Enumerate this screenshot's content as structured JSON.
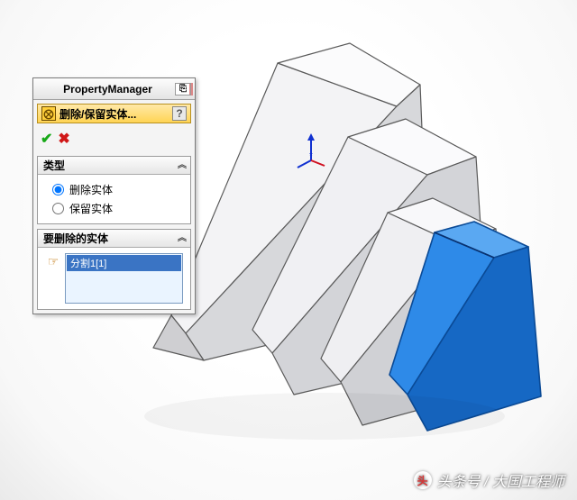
{
  "panel": {
    "title": "PropertyManager",
    "feature_name": "删除/保留实体...",
    "help_label": "?"
  },
  "actions": {
    "ok": "✔",
    "cancel": "✖"
  },
  "type_group": {
    "header": "类型",
    "option_delete": "删除实体",
    "option_keep": "保留实体",
    "selected": "delete"
  },
  "bodies_group": {
    "header": "要删除的实体",
    "items": [
      "分割1[1]"
    ]
  },
  "watermark": {
    "text": "头条号 / 大国工程师"
  },
  "icons": {
    "feature": "⨂",
    "pin": "⎘",
    "chevron": "︽",
    "pointer": "☞"
  },
  "colors": {
    "selected_face": "#1b7de0",
    "selected_edge": "#0a3f82",
    "model_face": "#e8e9eb",
    "model_edge": "#5a5a5a"
  }
}
